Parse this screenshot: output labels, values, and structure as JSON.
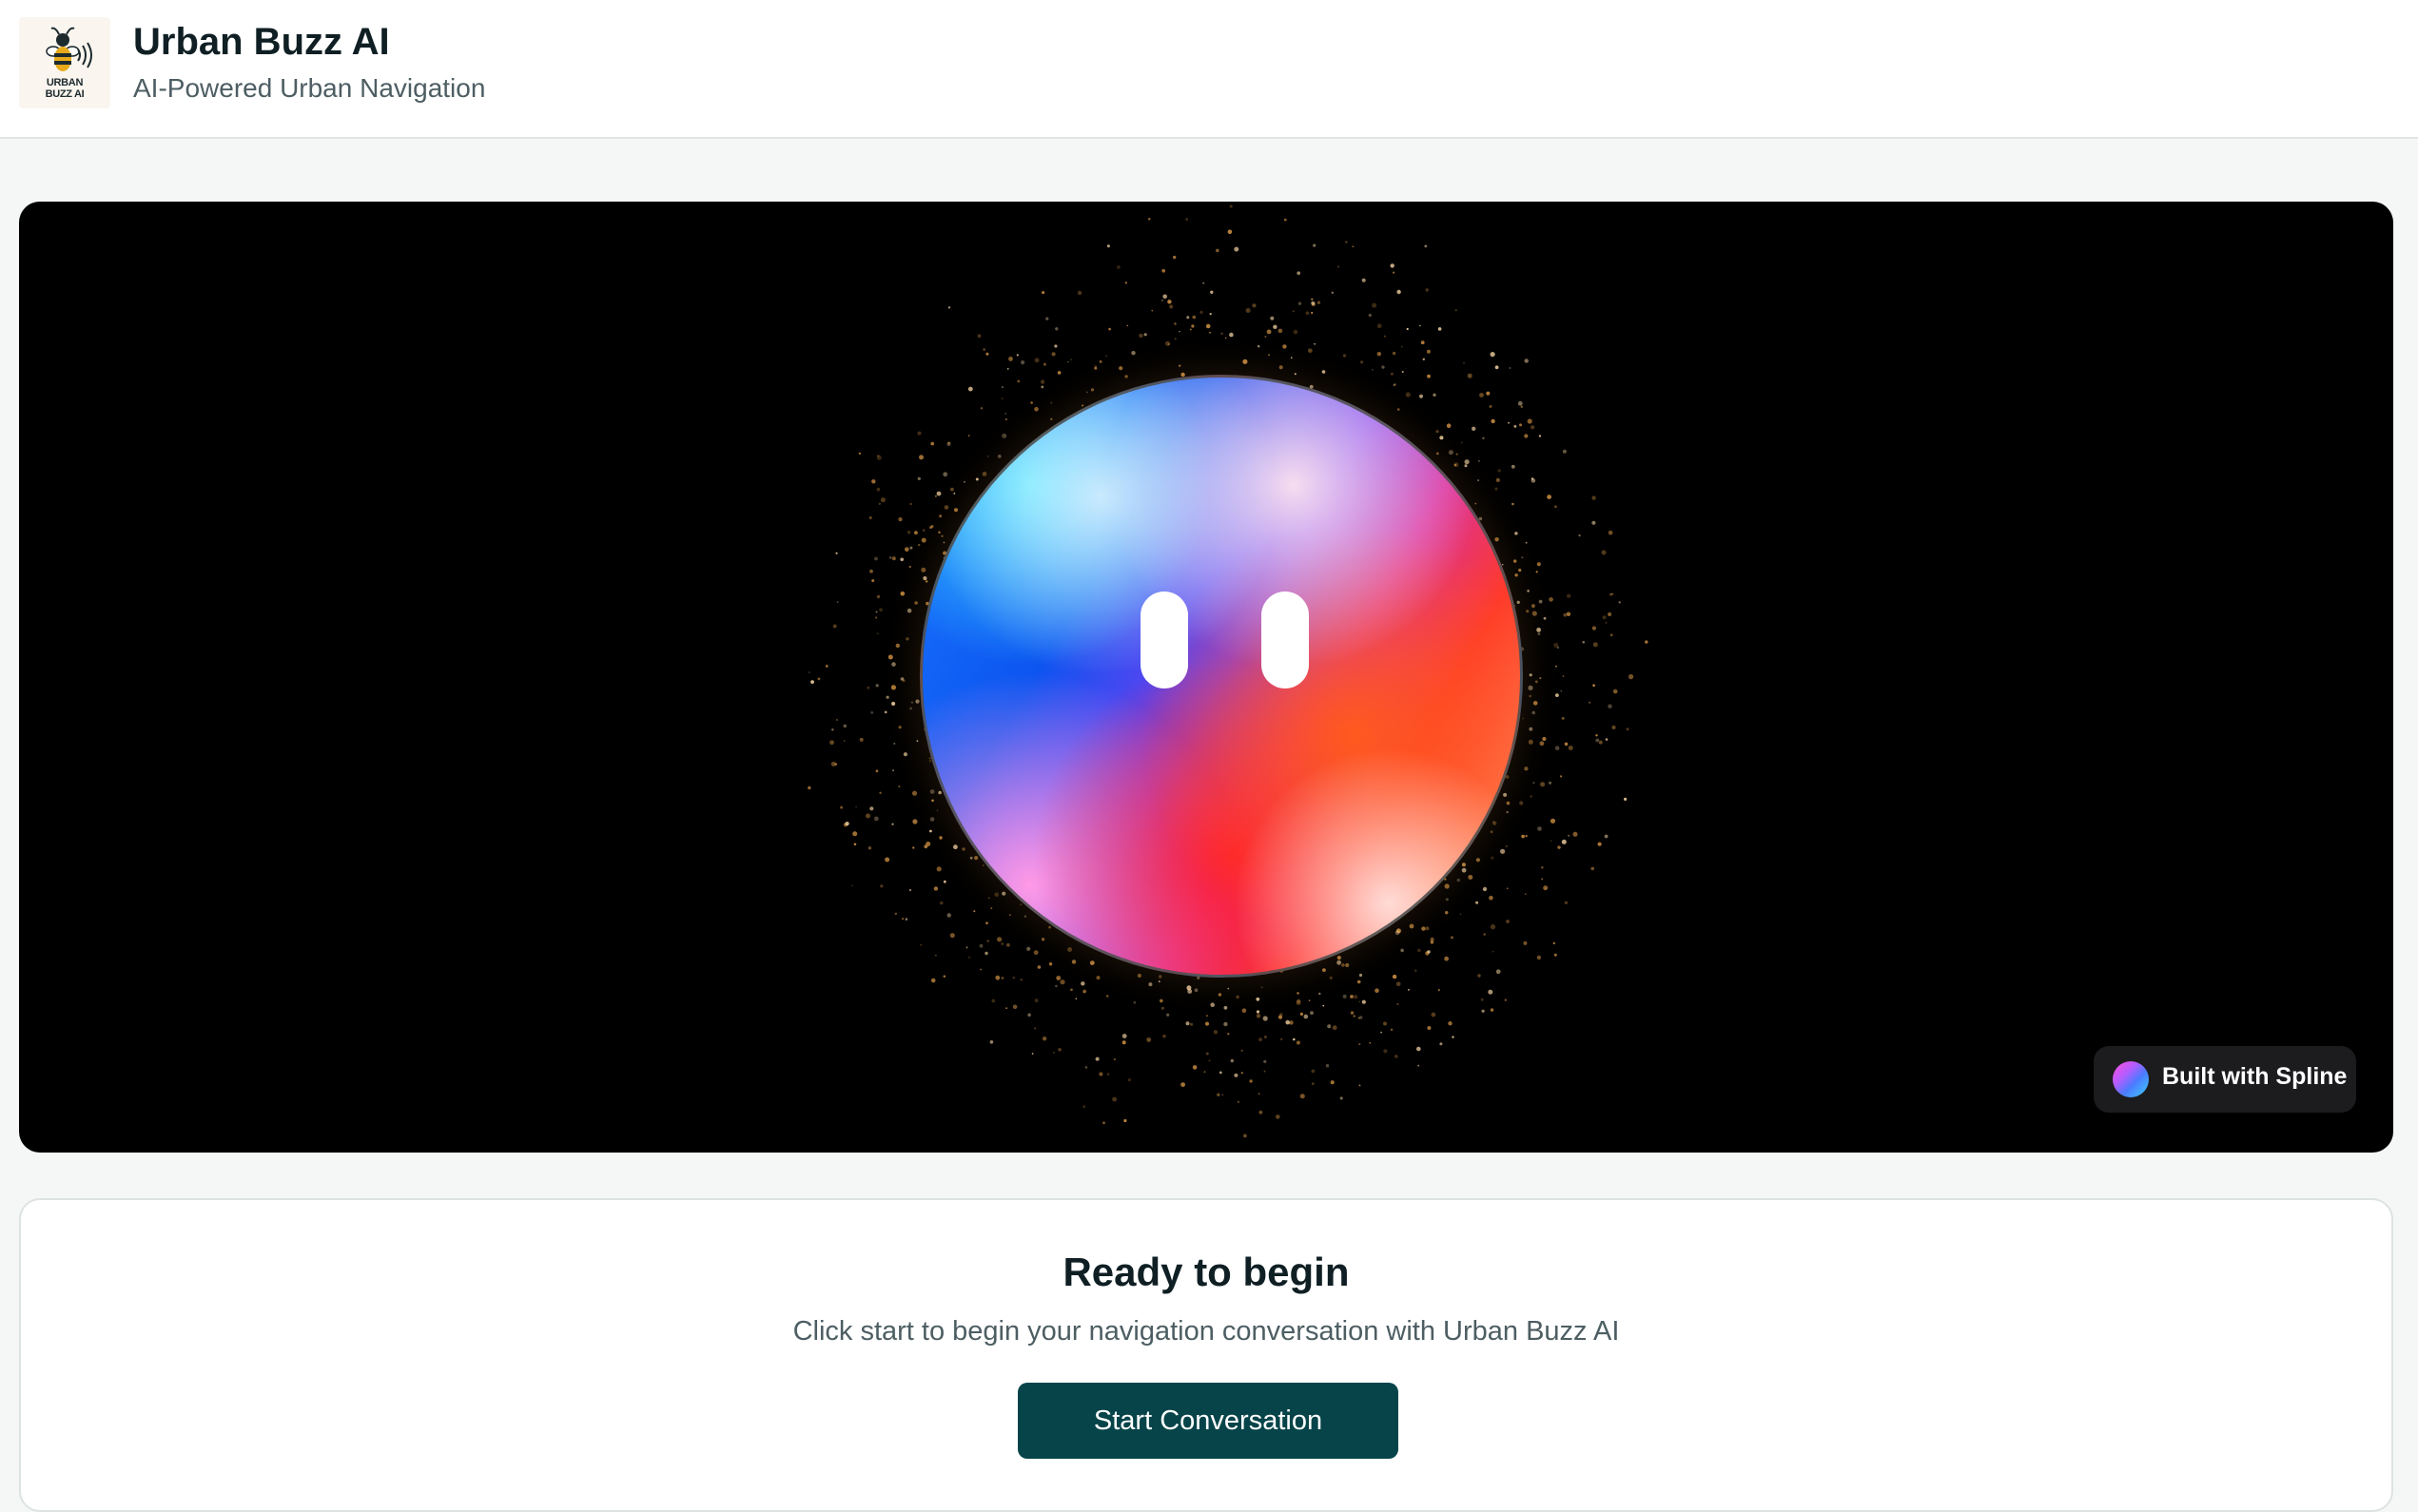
{
  "header": {
    "logo_text": [
      "URBAN",
      "BUZZ AI"
    ],
    "title": "Urban Buzz AI",
    "subtitle": "AI-Powered Urban Navigation"
  },
  "scene": {
    "badge_label": "Built with Spline"
  },
  "card": {
    "title": "Ready to begin",
    "description": "Click start to begin your navigation conversation with Urban Buzz AI",
    "start_label": "Start Conversation"
  },
  "colors": {
    "accent": "#064449",
    "stage_bg": "#000000",
    "page_bg": "#f4f7f6"
  },
  "icons": {
    "logo": "bee-with-sound-waves-icon",
    "badge": "spline-logo-icon"
  }
}
